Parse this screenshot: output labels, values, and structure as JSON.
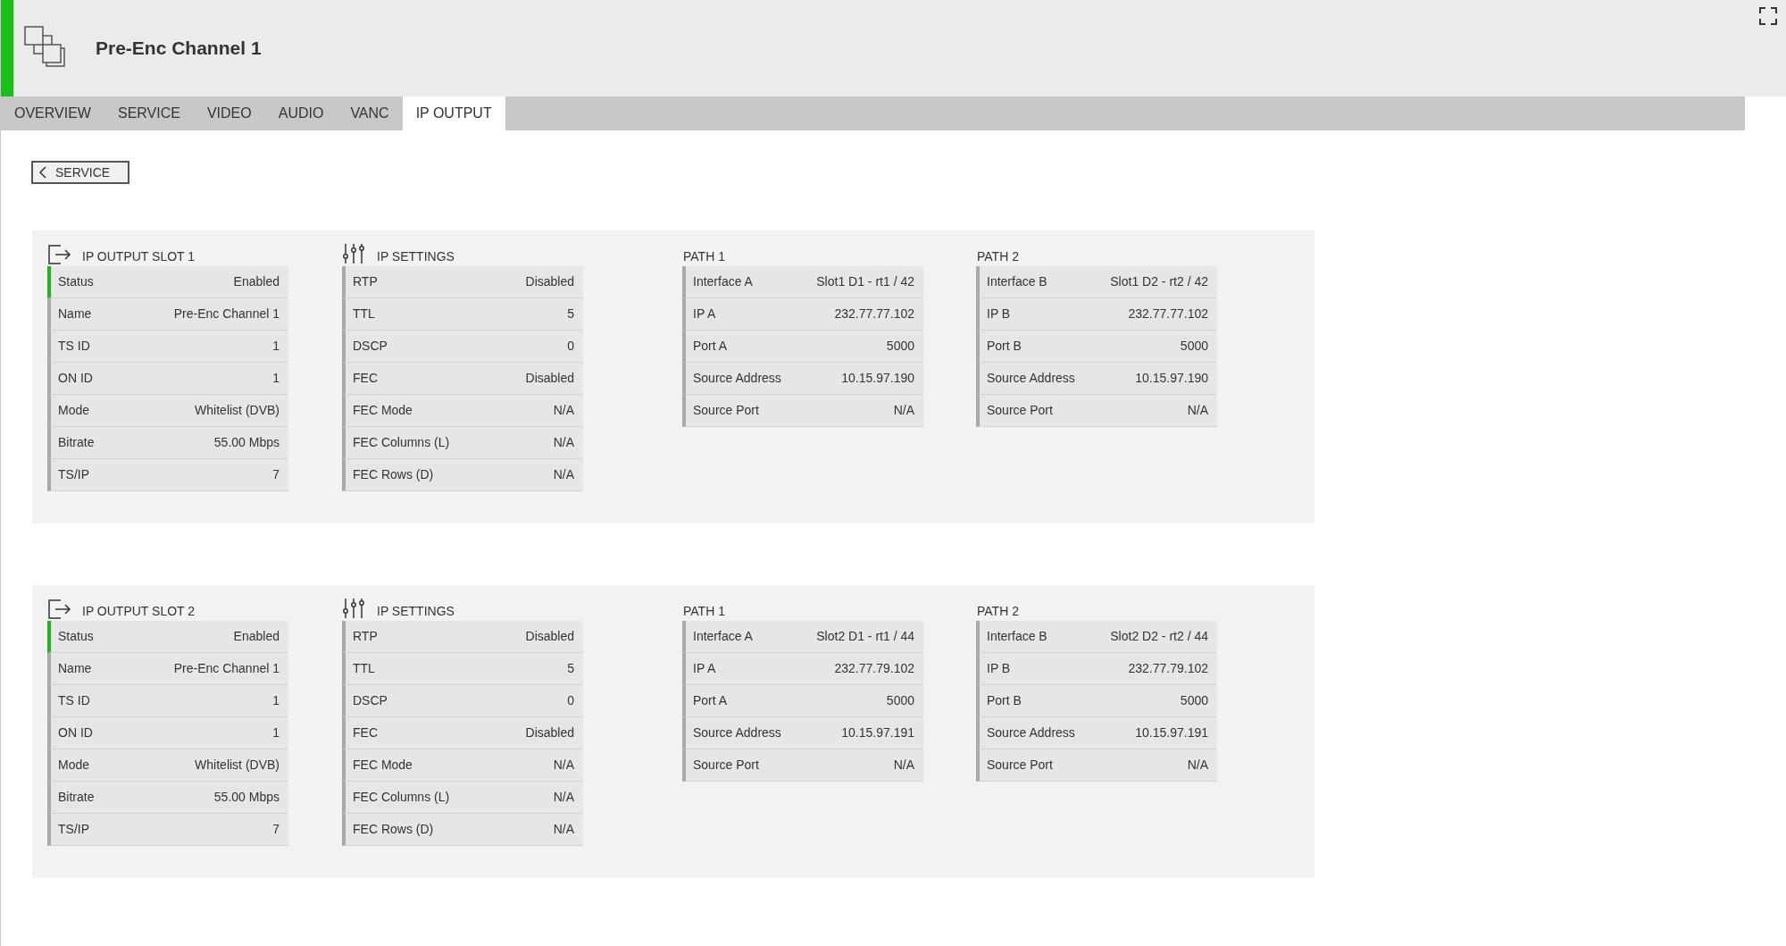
{
  "header": {
    "title": "Pre-Enc Channel 1"
  },
  "tabs": [
    {
      "label": "OVERVIEW",
      "selected": false
    },
    {
      "label": "SERVICE",
      "selected": false
    },
    {
      "label": "VIDEO",
      "selected": false
    },
    {
      "label": "AUDIO",
      "selected": false
    },
    {
      "label": "VANC",
      "selected": false
    },
    {
      "label": "IP OUTPUT",
      "selected": true
    }
  ],
  "back_button": {
    "label": "SERVICE"
  },
  "slots": [
    {
      "panels": [
        {
          "kind": "output",
          "title": "IP OUTPUT SLOT 1",
          "rows": [
            {
              "label": "Status",
              "value": "Enabled",
              "active": true
            },
            {
              "label": "Name",
              "value": "Pre-Enc Channel 1",
              "active": false
            },
            {
              "label": "TS ID",
              "value": "1",
              "active": false
            },
            {
              "label": "ON ID",
              "value": "1",
              "active": false
            },
            {
              "label": "Mode",
              "value": "Whitelist (DVB)",
              "active": false
            },
            {
              "label": "Bitrate",
              "value": "55.00 Mbps",
              "active": false
            },
            {
              "label": "TS/IP",
              "value": "7",
              "active": false
            }
          ]
        },
        {
          "kind": "settings",
          "title": "IP SETTINGS",
          "rows": [
            {
              "label": "RTP",
              "value": "Disabled",
              "active": false
            },
            {
              "label": "TTL",
              "value": "5",
              "active": false
            },
            {
              "label": "DSCP",
              "value": "0",
              "active": false
            },
            {
              "label": "FEC",
              "value": "Disabled",
              "active": false
            },
            {
              "label": "FEC Mode",
              "value": "N/A",
              "active": false
            },
            {
              "label": "FEC Columns (L)",
              "value": "N/A",
              "active": false
            },
            {
              "label": "FEC Rows (D)",
              "value": "N/A",
              "active": false
            }
          ]
        },
        {
          "kind": "path",
          "title": "PATH 1",
          "rows": [
            {
              "label": "Interface A",
              "value": "Slot1 D1 - rt1 / 42",
              "active": false
            },
            {
              "label": "IP A",
              "value": "232.77.77.102",
              "active": false
            },
            {
              "label": "Port A",
              "value": "5000",
              "active": false
            },
            {
              "label": "Source Address",
              "value": "10.15.97.190",
              "active": false
            },
            {
              "label": "Source Port",
              "value": "N/A",
              "active": false
            }
          ]
        },
        {
          "kind": "path",
          "title": "PATH 2",
          "rows": [
            {
              "label": "Interface B",
              "value": "Slot1 D2 - rt2 / 42",
              "active": false
            },
            {
              "label": "IP B",
              "value": "232.77.77.102",
              "active": false
            },
            {
              "label": "Port B",
              "value": "5000",
              "active": false
            },
            {
              "label": "Source Address",
              "value": "10.15.97.190",
              "active": false
            },
            {
              "label": "Source Port",
              "value": "N/A",
              "active": false
            }
          ]
        }
      ]
    },
    {
      "panels": [
        {
          "kind": "output",
          "title": "IP OUTPUT SLOT 2",
          "rows": [
            {
              "label": "Status",
              "value": "Enabled",
              "active": true
            },
            {
              "label": "Name",
              "value": "Pre-Enc Channel 1",
              "active": false
            },
            {
              "label": "TS ID",
              "value": "1",
              "active": false
            },
            {
              "label": "ON ID",
              "value": "1",
              "active": false
            },
            {
              "label": "Mode",
              "value": "Whitelist (DVB)",
              "active": false
            },
            {
              "label": "Bitrate",
              "value": "55.00 Mbps",
              "active": false
            },
            {
              "label": "TS/IP",
              "value": "7",
              "active": false
            }
          ]
        },
        {
          "kind": "settings",
          "title": "IP SETTINGS",
          "rows": [
            {
              "label": "RTP",
              "value": "Disabled",
              "active": false
            },
            {
              "label": "TTL",
              "value": "5",
              "active": false
            },
            {
              "label": "DSCP",
              "value": "0",
              "active": false
            },
            {
              "label": "FEC",
              "value": "Disabled",
              "active": false
            },
            {
              "label": "FEC Mode",
              "value": "N/A",
              "active": false
            },
            {
              "label": "FEC Columns (L)",
              "value": "N/A",
              "active": false
            },
            {
              "label": "FEC Rows (D)",
              "value": "N/A",
              "active": false
            }
          ]
        },
        {
          "kind": "path",
          "title": "PATH 1",
          "rows": [
            {
              "label": "Interface A",
              "value": "Slot2 D1 - rt1 / 44",
              "active": false
            },
            {
              "label": "IP A",
              "value": "232.77.79.102",
              "active": false
            },
            {
              "label": "Port A",
              "value": "5000",
              "active": false
            },
            {
              "label": "Source Address",
              "value": "10.15.97.191",
              "active": false
            },
            {
              "label": "Source Port",
              "value": "N/A",
              "active": false
            }
          ]
        },
        {
          "kind": "path",
          "title": "PATH 2",
          "rows": [
            {
              "label": "Interface B",
              "value": "Slot2 D2 - rt2 / 44",
              "active": false
            },
            {
              "label": "IP B",
              "value": "232.77.79.102",
              "active": false
            },
            {
              "label": "Port B",
              "value": "5000",
              "active": false
            },
            {
              "label": "Source Address",
              "value": "10.15.97.191",
              "active": false
            },
            {
              "label": "Source Port",
              "value": "N/A",
              "active": false
            }
          ]
        }
      ]
    }
  ]
}
